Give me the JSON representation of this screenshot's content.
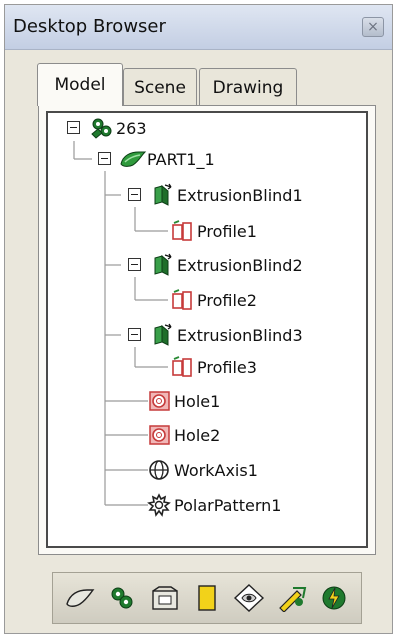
{
  "window": {
    "title": "Desktop Browser",
    "close_glyph": "×"
  },
  "tabs": [
    {
      "label": "Model",
      "active": true
    },
    {
      "label": "Scene",
      "active": false
    },
    {
      "label": "Drawing",
      "active": false
    }
  ],
  "tree": {
    "root": {
      "label": "263",
      "icon": "assembly-icon"
    },
    "part": {
      "label": "PART1_1",
      "icon": "part-icon"
    },
    "features": [
      {
        "label": "ExtrusionBlind1",
        "icon": "extrusion-icon"
      },
      {
        "label": "Profile1",
        "icon": "profile-icon"
      },
      {
        "label": "ExtrusionBlind2",
        "icon": "extrusion-icon"
      },
      {
        "label": "Profile2",
        "icon": "profile-icon"
      },
      {
        "label": "ExtrusionBlind3",
        "icon": "extrusion-icon"
      },
      {
        "label": "Profile3",
        "icon": "profile-icon"
      },
      {
        "label": "Hole1",
        "icon": "hole-icon"
      },
      {
        "label": "Hole2",
        "icon": "hole-icon"
      },
      {
        "label": "WorkAxis1",
        "icon": "work-axis-icon"
      },
      {
        "label": "PolarPattern1",
        "icon": "polar-pattern-icon"
      }
    ]
  },
  "toolbar": {
    "buttons": [
      "part-tool-icon",
      "assembly-tool-icon",
      "folder-tool-icon",
      "sheet-tool-icon",
      "view-tool-icon",
      "sketch-tool-icon",
      "lightning-tool-icon"
    ]
  },
  "colors": {
    "panel_bg": "#eae7dc",
    "title_bg": "#c3cee3",
    "icon_green": "#1f7a2e",
    "icon_red": "#c63b3b"
  }
}
